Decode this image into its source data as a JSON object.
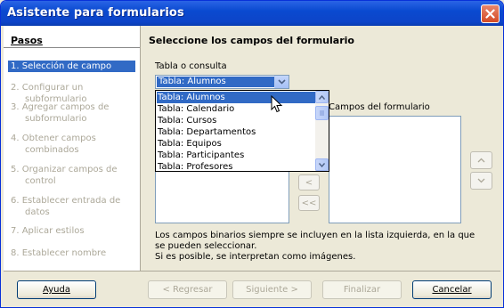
{
  "window": {
    "title": "Asistente para formularios"
  },
  "sidebar": {
    "title": "Pasos",
    "steps": [
      {
        "label": "1. Selección de campo",
        "active": true
      },
      {
        "label": "2. Configurar un subformulario",
        "active": false
      },
      {
        "label": "3. Agregar campos de subformulario",
        "active": false
      },
      {
        "label": "4. Obtener campos combinados",
        "active": false
      },
      {
        "label": "5. Organizar campos de control",
        "active": false
      },
      {
        "label": "6. Establecer entrada de datos",
        "active": false
      },
      {
        "label": "7. Aplicar estilos",
        "active": false
      },
      {
        "label": "8. Establecer nombre",
        "active": false
      }
    ]
  },
  "main": {
    "title": "Seleccione los campos del formulario",
    "table_label": "Tabla o consulta",
    "table_value": "Tabla: Alumnos",
    "form_fields_label": "Campos del formulario",
    "transfer_buttons": {
      "remove_one": "<",
      "remove_all": "<<"
    },
    "note_line1": "Los campos binarios siempre se incluyen en la lista izquierda, en la que se pueden seleccionar.",
    "note_line2": "Si es posible, se interpretan como imágenes."
  },
  "dropdown": {
    "options": [
      "Tabla: Alumnos",
      "Tabla: Calendario",
      "Tabla: Cursos",
      "Tabla: Departamentos",
      "Tabla: Equipos",
      "Tabla: Participantes",
      "Tabla: Profesores"
    ],
    "selected": "Tabla: Alumnos"
  },
  "buttons": {
    "help": "Ayuda",
    "back": "< Regresar",
    "next": "Siguiente >",
    "finish": "Finalizar",
    "cancel": "Cancelar"
  },
  "colors": {
    "titlebar": "#0a4ad0",
    "selection": "#316ac5",
    "disabled_text": "#aca899",
    "dialog_bg": "#ece9d8"
  }
}
